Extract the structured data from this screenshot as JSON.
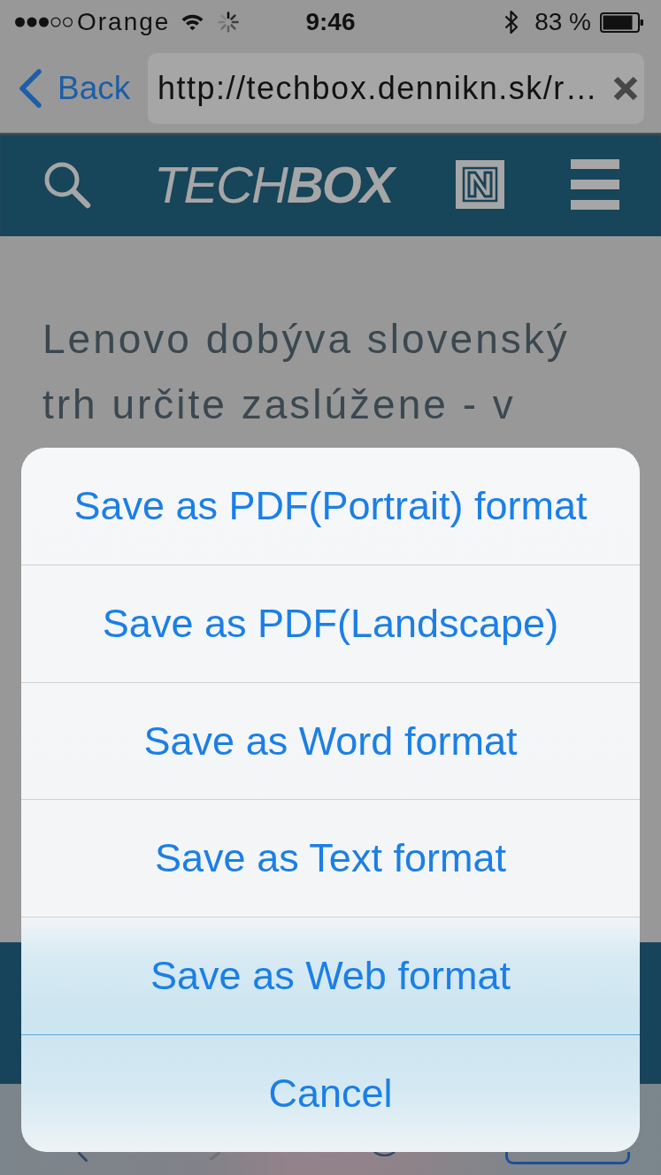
{
  "status_bar": {
    "carrier": "Orange",
    "time": "9:46",
    "battery": "83 %"
  },
  "nav_bar": {
    "back": "Back",
    "url": "http://techbox.dennikn.sk/r…"
  },
  "site_header": {
    "logo": "TECH**BOX**"
  },
  "article": {
    "heading": "Lenovo dobýva slovenský trh určite zaslúžene - v"
  },
  "action_sheet": {
    "options": [
      "Save as PDF(Portrait) format",
      "Save as PDF(Landscape)",
      "Save as Word format",
      "Save as Text format",
      "Save as Web format"
    ],
    "cancel": "Cancel"
  }
}
